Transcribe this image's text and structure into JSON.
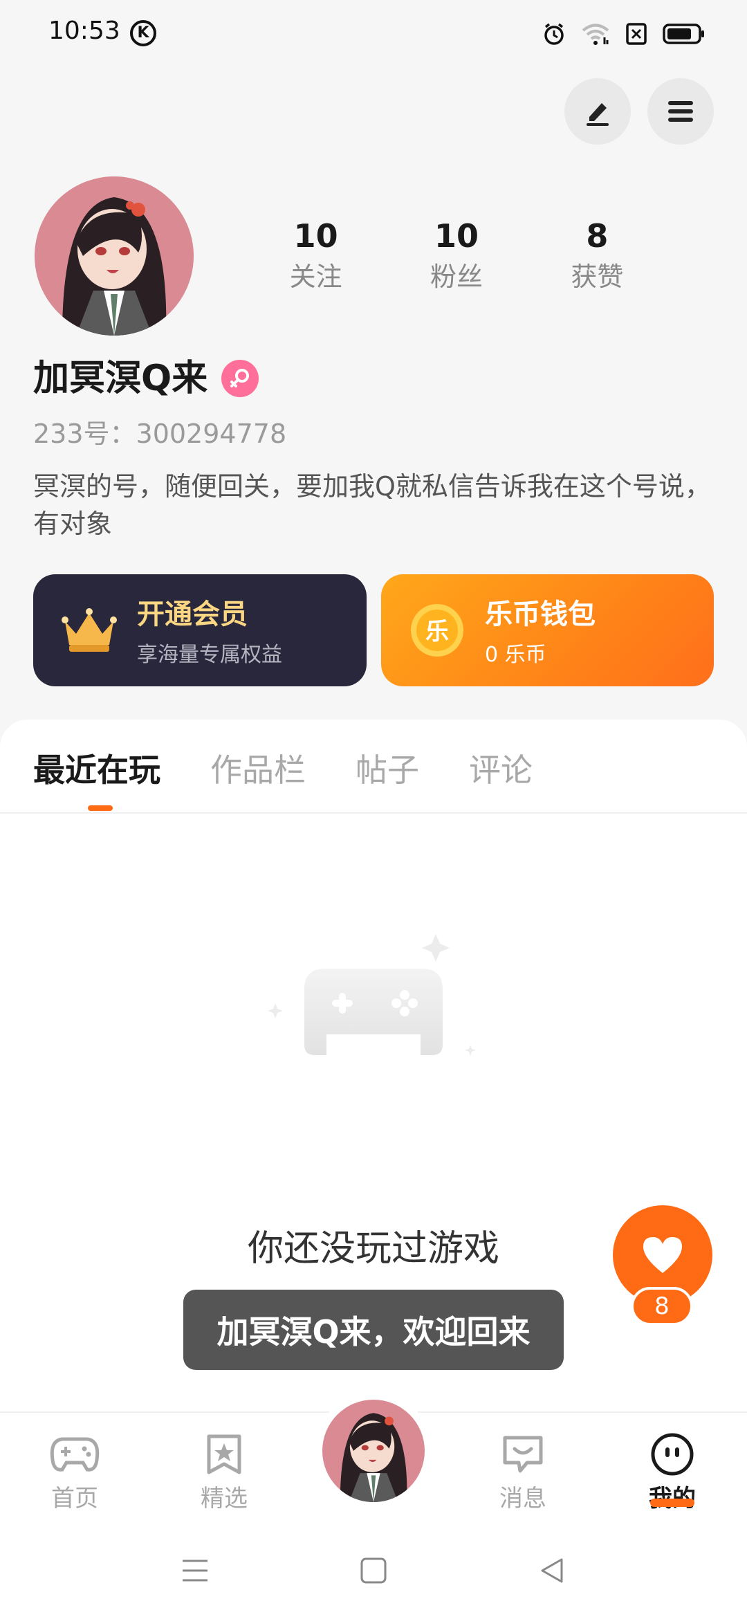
{
  "status_bar": {
    "time": "10:53",
    "app_icon": "k-icon",
    "icons": [
      "alarm-icon",
      "wifi-icon",
      "sim-icon",
      "battery-icon"
    ]
  },
  "toolbar": {
    "edit_icon": "pencil-icon",
    "menu_icon": "hamburger-menu-icon"
  },
  "profile": {
    "stats": [
      {
        "value": "10",
        "label": "关注"
      },
      {
        "value": "10",
        "label": "粉丝"
      },
      {
        "value": "8",
        "label": "获赞"
      }
    ],
    "username": "加冥溟Q来",
    "gender_icon": "female-icon",
    "user_id": "233号：300294778",
    "bio": "冥溟的号，随便回关，要加我Q就私信告诉我在这个号说，有对象"
  },
  "cards": {
    "vip": {
      "title": "开通会员",
      "subtitle": "享海量专属权益",
      "icon": "crown-icon"
    },
    "wallet": {
      "title": "乐币钱包",
      "subtitle": "0 乐币",
      "icon_text": "乐",
      "icon": "coin-icon"
    }
  },
  "tabs": [
    {
      "label": "最近在玩",
      "active": true
    },
    {
      "label": "作品栏",
      "active": false
    },
    {
      "label": "帖子",
      "active": false
    },
    {
      "label": "评论",
      "active": false
    }
  ],
  "empty_state": {
    "icon": "gamepad-icon",
    "text": "你还没玩过游戏"
  },
  "toast": {
    "text": "加冥溟Q来，欢迎回来"
  },
  "like_fab": {
    "icon": "heart-icon",
    "count": "8"
  },
  "bottom_nav": [
    {
      "label": "首页",
      "icon": "gamepad-icon",
      "active": false
    },
    {
      "label": "精选",
      "icon": "star-bookmark-icon",
      "active": false
    },
    {
      "label": "",
      "icon": "avatar",
      "active": false
    },
    {
      "label": "消息",
      "icon": "chat-icon",
      "active": false
    },
    {
      "label": "我的",
      "icon": "face-icon",
      "active": true
    }
  ],
  "colors": {
    "accent": "#ff6a14",
    "vip_card_bg": "#28273b",
    "vip_title": "#fcd783",
    "wallet_gradient_start": "#ffa81a",
    "wallet_gradient_end": "#ff6f1b",
    "gender_badge": "#ff6f9a",
    "toast_bg": "#555555"
  }
}
